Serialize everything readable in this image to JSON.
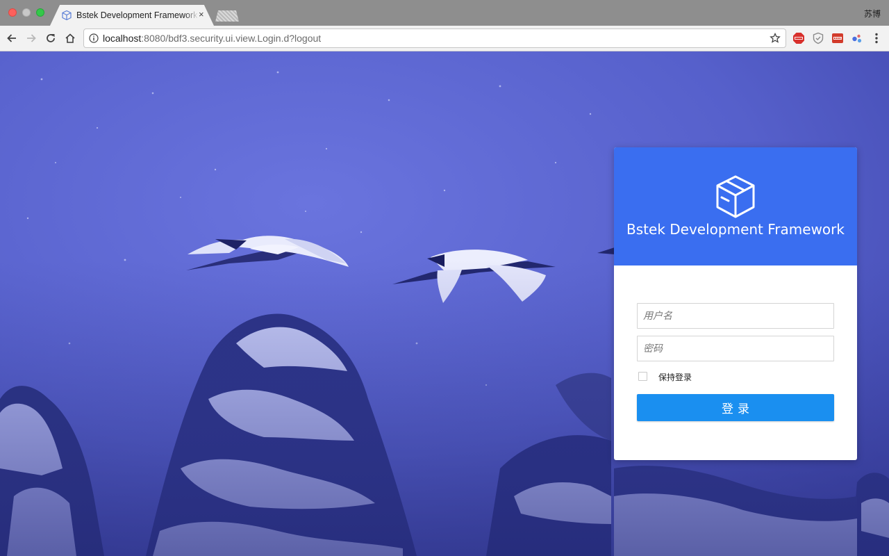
{
  "browser": {
    "tab": {
      "title": "Bstek Development Framework",
      "close_glyph": "×",
      "icon": "cube-icon"
    },
    "profile_name": "苏博",
    "address": {
      "host": "localhost",
      "path": ":8080/bdf3.security.ui.view.Login.d?logout"
    },
    "extensions": [
      "abp-extension-icon",
      "shield-extension-icon",
      "cors-extension-icon",
      "dots-extension-icon"
    ]
  },
  "login": {
    "app_title": "Bstek Development Framework",
    "username_placeholder": "用户名",
    "password_placeholder": "密码",
    "remember_label": "保持登录",
    "submit_label": "登录"
  },
  "colors": {
    "header_blue": "#3a6ef0",
    "button_blue": "#1a8ff0",
    "background_tint": "#5a64d0"
  }
}
